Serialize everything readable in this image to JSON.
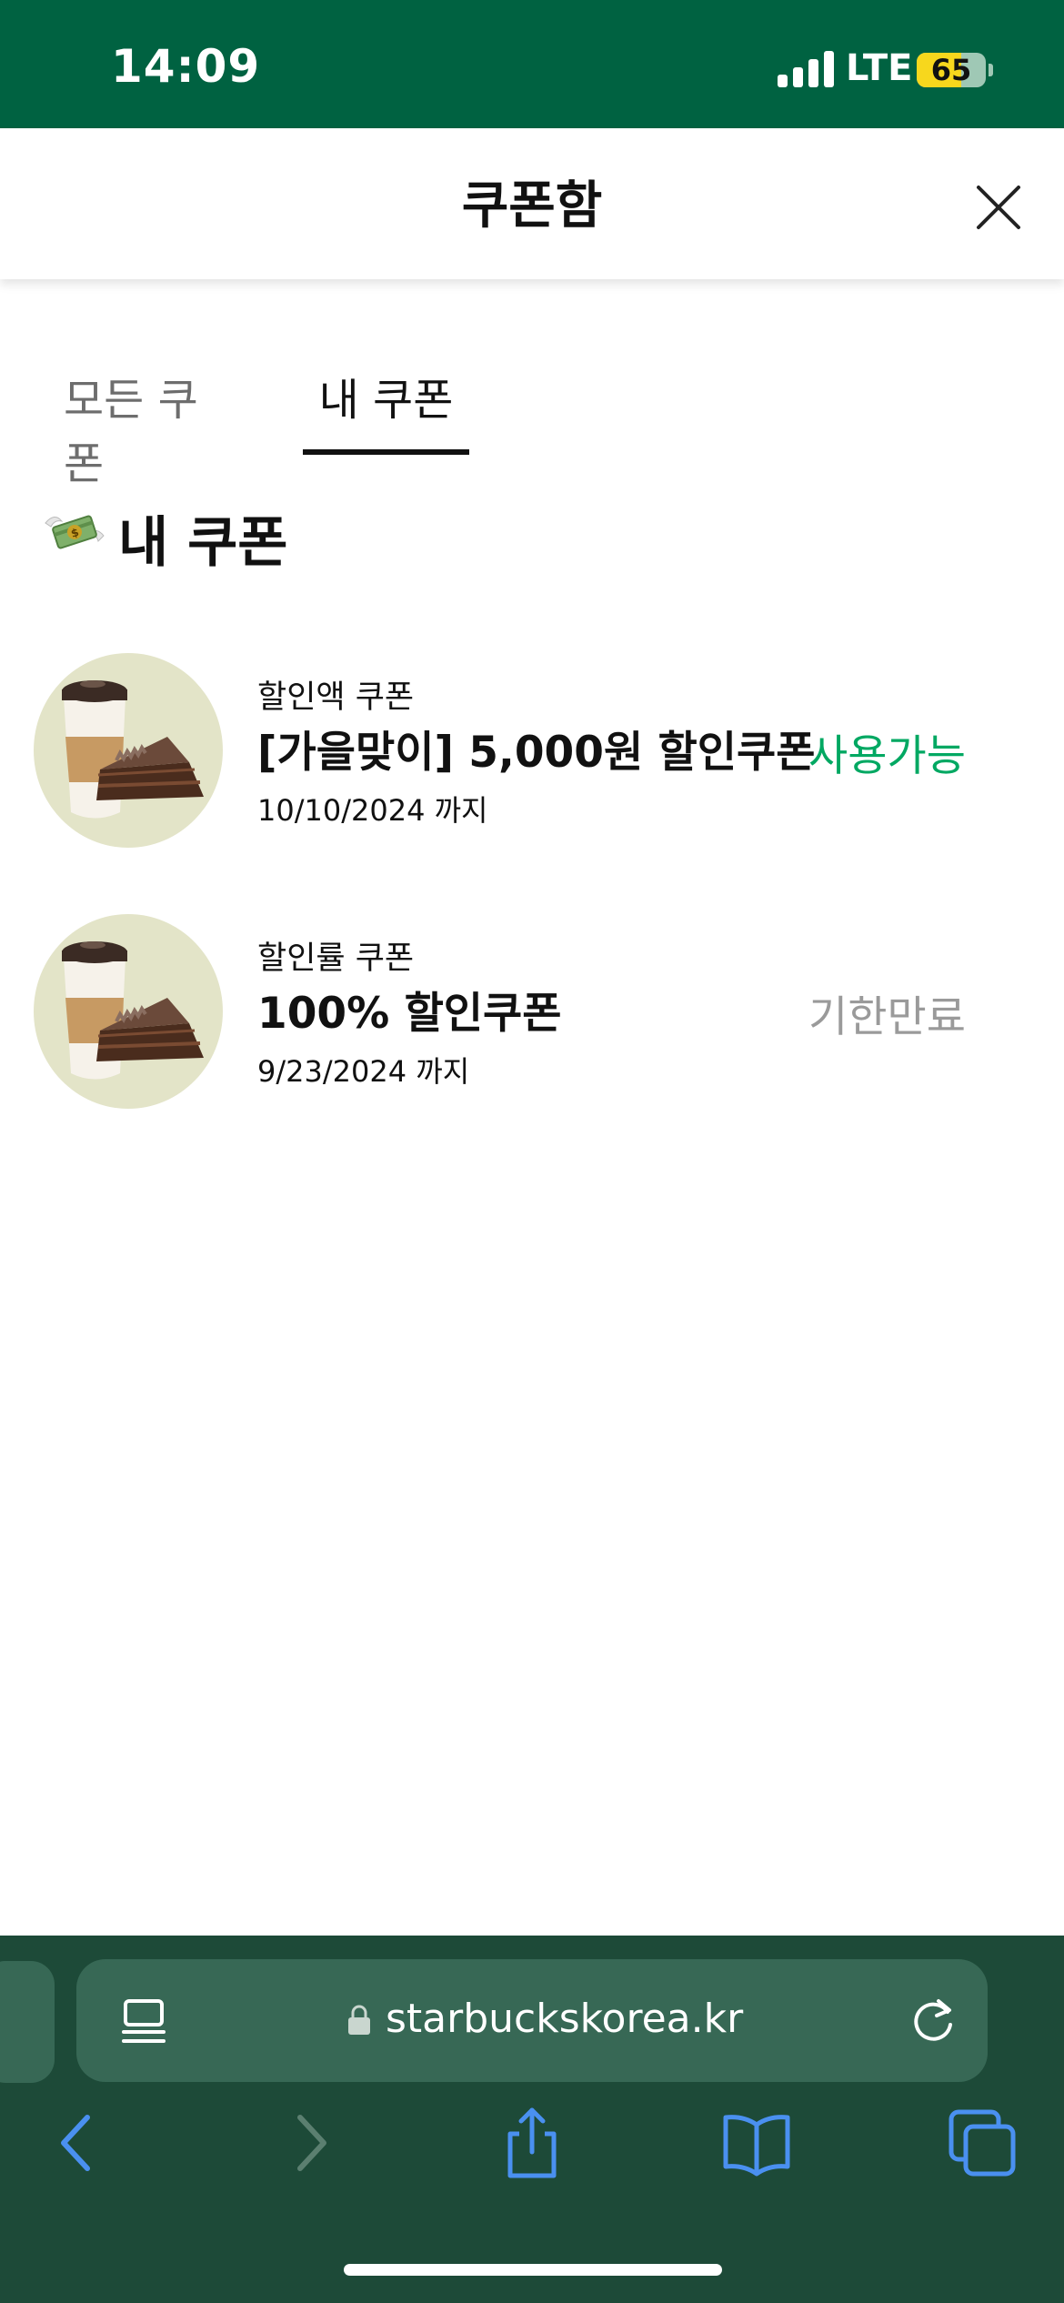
{
  "status_bar": {
    "time": "14:09",
    "network": "LTE",
    "battery": "65",
    "battery_level": 0.65
  },
  "header": {
    "title": "쿠폰함"
  },
  "tabs": [
    {
      "label": "모든 쿠폰",
      "selected": false
    },
    {
      "label": "내 쿠폰",
      "selected": true
    }
  ],
  "section": {
    "title": "내 쿠폰",
    "icon": "money-with-wings-icon"
  },
  "coupons": [
    {
      "type": "할인액 쿠폰",
      "name": "[가을맞이] 5,000원 할인쿠폰",
      "date": "10/10/2024 까지",
      "status": "사용가능",
      "image": "coffee-cake-icon"
    },
    {
      "type": "할인률 쿠폰",
      "name": "100% 할인쿠폰",
      "date": "9/23/2024 까지",
      "status": "기한만료",
      "image": "coffee-cake-icon"
    }
  ],
  "browser": {
    "url": "starbuckskorea.kr"
  },
  "colors": {
    "brand_green": "#006241",
    "available": "#00a862",
    "expired": "#9a9a9a",
    "browser_bar": "#1d4a38"
  }
}
